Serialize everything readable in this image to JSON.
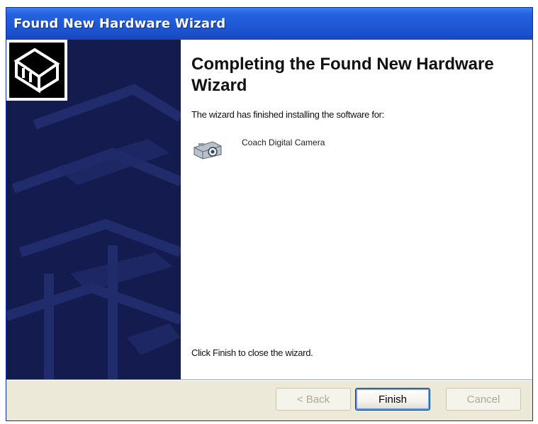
{
  "window": {
    "title": "Found New Hardware Wizard"
  },
  "content": {
    "heading": "Completing the Found New Hardware Wizard",
    "intro_text": "The wizard has finished installing the software for:",
    "device": {
      "icon": "camera-icon",
      "name": "Coach Digital Camera"
    },
    "closing_text": "Click Finish to close the wizard."
  },
  "buttons": {
    "back": {
      "label": "< Back",
      "enabled": false
    },
    "finish": {
      "label": "Finish",
      "enabled": true,
      "default": true
    },
    "cancel": {
      "label": "Cancel",
      "enabled": false
    }
  },
  "colors": {
    "titlebar": "#1f58d6",
    "side_panel": "#141b4e",
    "dialog_face": "#ece9d8"
  }
}
